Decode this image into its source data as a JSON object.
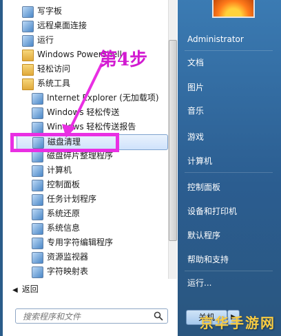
{
  "left_items": [
    {
      "label": "写字板",
      "icon": "wordpad-icon",
      "level": 1
    },
    {
      "label": "远程桌面连接",
      "icon": "remote-desktop-icon",
      "level": 1
    },
    {
      "label": "运行",
      "icon": "run-icon",
      "level": 1
    },
    {
      "label": "Windows PowerShell",
      "icon": "folder-icon",
      "level": 1
    },
    {
      "label": "轻松访问",
      "icon": "folder-icon",
      "level": 1
    },
    {
      "label": "系统工具",
      "icon": "folder-icon",
      "level": 1
    },
    {
      "label": "Internet Explorer (无加载项)",
      "icon": "internet-explorer-icon",
      "level": 2
    },
    {
      "label": "Windows 轻松传送",
      "icon": "easy-transfer-icon",
      "level": 2
    },
    {
      "label": "Windows 轻松传送报告",
      "icon": "easy-transfer-report-icon",
      "level": 2
    },
    {
      "label": "磁盘清理",
      "icon": "disk-cleanup-icon",
      "level": 2,
      "selected": true
    },
    {
      "label": "磁盘碎片整理程序",
      "icon": "defrag-icon",
      "level": 2
    },
    {
      "label": "计算机",
      "icon": "computer-icon",
      "level": 2
    },
    {
      "label": "控制面板",
      "icon": "control-panel-icon",
      "level": 2
    },
    {
      "label": "任务计划程序",
      "icon": "task-scheduler-icon",
      "level": 2
    },
    {
      "label": "系统还原",
      "icon": "system-restore-icon",
      "level": 2
    },
    {
      "label": "系统信息",
      "icon": "system-info-icon",
      "level": 2
    },
    {
      "label": "专用字符编辑程序",
      "icon": "char-editor-icon",
      "level": 2
    },
    {
      "label": "资源监视器",
      "icon": "resource-monitor-icon",
      "level": 2
    },
    {
      "label": "字符映射表",
      "icon": "char-map-icon",
      "level": 2
    }
  ],
  "back_label": "返回",
  "search_placeholder": "搜索程序和文件",
  "right_items": [
    "Administrator",
    "文档",
    "图片",
    "音乐",
    "游戏",
    "计算机",
    "控制面板",
    "设备和打印机",
    "默认程序",
    "帮助和支持",
    "运行..."
  ],
  "shutdown_label": "关机",
  "annotation": "第4步",
  "watermark": "京华手游网",
  "colors": {
    "annotation": "#e92fe3",
    "right_panel": "#2b5d90",
    "selection": "#cfe2fb"
  }
}
